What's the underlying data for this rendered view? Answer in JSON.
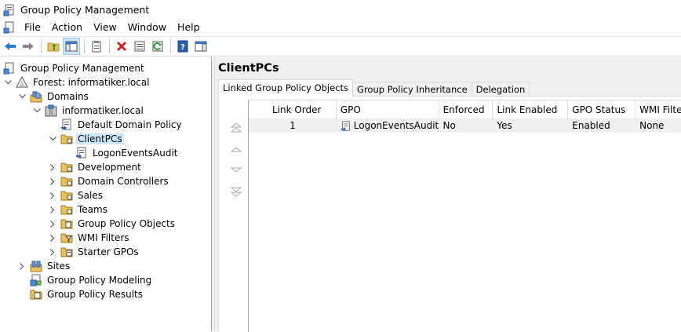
{
  "window": {
    "title": "Group Policy Management"
  },
  "menu": {
    "items": [
      "File",
      "Action",
      "View",
      "Window",
      "Help"
    ]
  },
  "toolbar": {
    "buttons": [
      "back-icon",
      "forward-icon",
      "up-folder-icon",
      "show-hide-tree-icon",
      "properties-icon",
      "delete-icon",
      "export-icon",
      "refresh-icon",
      "help-icon",
      "show-action-pane-icon"
    ]
  },
  "tree": {
    "root": "Group Policy Management",
    "forest": "Forest: informatiker.local",
    "domains": "Domains",
    "domain": "informatiker.local",
    "default_policy": "Default Domain Policy",
    "clientpcs": "ClientPCs",
    "gpo_link": "LogonEventsAudit",
    "ous": [
      "Development",
      "Domain Controllers",
      "Sales",
      "Teams"
    ],
    "gpo_objects": "Group Policy Objects",
    "wmi_filters": "WMI Filters",
    "starter_gpos": "Starter GPOs",
    "sites": "Sites",
    "modeling": "Group Policy Modeling",
    "results": "Group Policy Results"
  },
  "details": {
    "title": "ClientPCs",
    "tabs": [
      "Linked Group Policy Objects",
      "Group Policy Inheritance",
      "Delegation"
    ],
    "columns": [
      "Link Order",
      "GPO",
      "Enforced",
      "Link Enabled",
      "GPO Status",
      "WMI Filter"
    ],
    "rows": [
      {
        "link_order": "1",
        "gpo": "LogonEventsAudit",
        "enforced": "No",
        "link_enabled": "Yes",
        "gpo_status": "Enabled",
        "wmi_filter": "None"
      }
    ]
  },
  "colors": {
    "selection": "#cce8ff",
    "toolbar_pressed": "#cce4f7",
    "panel": "#f0f0f0"
  }
}
